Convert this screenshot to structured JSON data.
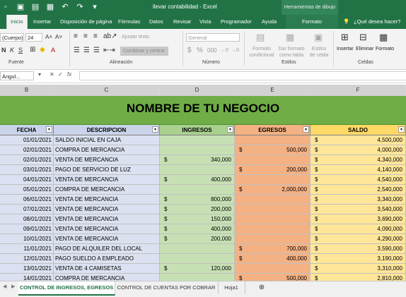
{
  "window": {
    "title": "llevar contabilidad  -  Excel",
    "drawing_tools": "Herramientas de dibujo"
  },
  "tabs": [
    "Inicio",
    "Insertar",
    "Disposición de página",
    "Fórmulas",
    "Datos",
    "Revisar",
    "Vista",
    "Programador",
    "Ayuda",
    "Formato"
  ],
  "active_tab": "Inicio",
  "tell_me": "¿Qué desea hacer?",
  "ribbon": {
    "font_name": "(Cuerpo)",
    "font_size": "24",
    "wrap_text": "Ajustar texto",
    "merge_center": "Combinar y centrar",
    "number_format": "General",
    "conditional_format": "Formato condicional",
    "format_table": "Dar formato como tabla",
    "cell_styles": "Estilos de celda",
    "insert": "Insertar",
    "delete": "Eliminar",
    "format": "Formato",
    "groups": {
      "font": "Fuente",
      "alignment": "Alineación",
      "number": "Número",
      "styles": "Estilos",
      "cells": "Celdas"
    }
  },
  "name_box": "Ángul...",
  "formula_icons": {
    "cancel": "✕",
    "enter": "✓",
    "fx": "fx"
  },
  "columns": [
    "B",
    "C",
    "D",
    "E",
    "F"
  ],
  "banner_title": "NOMBRE DE TU NEGOCIO",
  "headers": {
    "fecha": "FECHA",
    "descripcion": "DESCRIPCION",
    "ingresos": "INGRESOS",
    "egresos": "EGRESOS",
    "saldo": "SALDO"
  },
  "currency": "$",
  "rows": [
    {
      "fecha": "01/01/2021",
      "desc": "SALDO INICIAL EN CAJA",
      "ingreso": "",
      "egreso": "",
      "saldo": "4,500,000"
    },
    {
      "fecha": "02/01/2021",
      "desc": "COMPRA DE MERCANCIA",
      "ingreso": "",
      "egreso": "500,000",
      "saldo": "4,000,000"
    },
    {
      "fecha": "02/01/2021",
      "desc": "VENTA DE MERCANCIA",
      "ingreso": "340,000",
      "egreso": "",
      "saldo": "4,340,000"
    },
    {
      "fecha": "03/01/2021",
      "desc": "PAGO DE SERVICIO DE LUZ",
      "ingreso": "",
      "egreso": "200,000",
      "saldo": "4,140,000"
    },
    {
      "fecha": "04/01/2021",
      "desc": "VENTA DE MERCANCIA",
      "ingreso": "400,000",
      "egreso": "",
      "saldo": "4,540,000"
    },
    {
      "fecha": "05/01/2021",
      "desc": "COMPRA DE MERCANCIA",
      "ingreso": "",
      "egreso": "2,000,000",
      "saldo": "2,540,000"
    },
    {
      "fecha": "06/01/2021",
      "desc": "VENTA DE MERCANCIA",
      "ingreso": "800,000",
      "egreso": "",
      "saldo": "3,340,000"
    },
    {
      "fecha": "07/01/2021",
      "desc": "VENTA DE MERCANCIA",
      "ingreso": "200,000",
      "egreso": "",
      "saldo": "3,540,000"
    },
    {
      "fecha": "08/01/2021",
      "desc": "VENTA DE MERCANCIA",
      "ingreso": "150,000",
      "egreso": "",
      "saldo": "3,690,000"
    },
    {
      "fecha": "09/01/2021",
      "desc": "VENTA DE MERCANCIA",
      "ingreso": "400,000",
      "egreso": "",
      "saldo": "4,090,000"
    },
    {
      "fecha": "10/01/2021",
      "desc": "VENTA DE MERCANCIA",
      "ingreso": "200,000",
      "egreso": "",
      "saldo": "4,290,000"
    },
    {
      "fecha": "11/01/2021",
      "desc": "PAGO DE ALQUILER DEL LOCAL",
      "ingreso": "",
      "egreso": "700,000",
      "saldo": "3,590,000"
    },
    {
      "fecha": "12/01/2021",
      "desc": "PAGO SUELDO A EMPLEADO",
      "ingreso": "",
      "egreso": "400,000",
      "saldo": "3,190,000"
    },
    {
      "fecha": "13/01/2021",
      "desc": "VENTA DE 4 CAMISETAS",
      "ingreso": "120,000",
      "egreso": "",
      "saldo": "3,310,000"
    },
    {
      "fecha": "14/01/2021",
      "desc": "COMPRA DE MERCANCIA",
      "ingreso": "",
      "egreso": "500,000",
      "saldo": "2,810,000"
    }
  ],
  "sheets": [
    "CONTROL DE INGRESOS, EGRESOS",
    "CONTROL DE CUENTAS POR COBRAR",
    "Hoja1"
  ],
  "active_sheet": "CONTROL DE INGRESOS, EGRESOS",
  "add_sheet": "⊕"
}
